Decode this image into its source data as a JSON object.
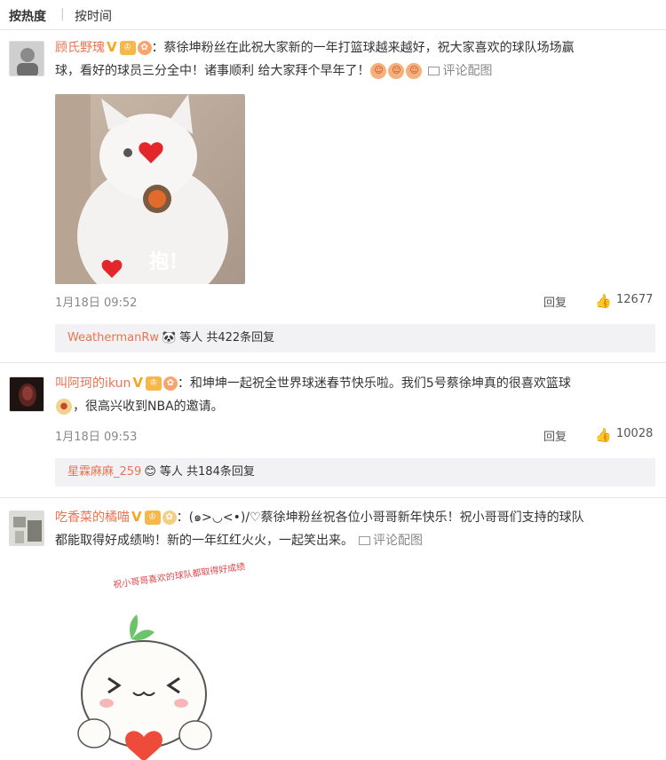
{
  "sort_tabs": {
    "hot": "按热度",
    "separator": "|",
    "time": "按时间"
  },
  "badges": {
    "v": "V",
    "member": "👑",
    "fan": "🔥"
  },
  "colors": {
    "username": "#eb7350",
    "meta": "#888888",
    "reply_bg": "#f2f2f5"
  },
  "comments": [
    {
      "username": "顾氏野瑰",
      "text_l1": "：蔡徐坤粉丝在此祝大家新的一年打篮球越来越好，祝大家喜欢的球队场场赢",
      "text_l2": "球，看好的球员三分全中！诸事顺利 给大家拜个早年了！",
      "pic_link": "评论配图",
      "image_caption": "抱！",
      "date": "1月18日 09:52",
      "reply_label": "回复",
      "likes": "12677",
      "replies_name": "WeathermanRw",
      "replies_icon": "🐼",
      "replies_text": "等人 共422条回复"
    },
    {
      "username": "叫阿珂的ikun",
      "text_l1": "：和坤坤一起祝全世界球迷春节快乐啦。我们5号蔡徐坤真的很喜欢篮球",
      "text_l2": "，很高兴收到NBA的邀请。",
      "date": "1月18日 09:53",
      "reply_label": "回复",
      "likes": "10028",
      "replies_name": "星霖麻麻_259",
      "replies_icon": "😊",
      "replies_text": "等人 共184条回复"
    },
    {
      "username": "吃香菜的橘喵",
      "text_l1": "：(๑>◡<•)/♡蔡徐坤粉丝祝各位小哥哥新年快乐！祝小哥哥们支持的球队",
      "text_l2": "都能取得好成绩哟！新的一年红红火火，一起笑出来。",
      "pic_link": "评论配图",
      "image_note": "祝小哥哥喜欢的球队都取得好成绩"
    }
  ]
}
